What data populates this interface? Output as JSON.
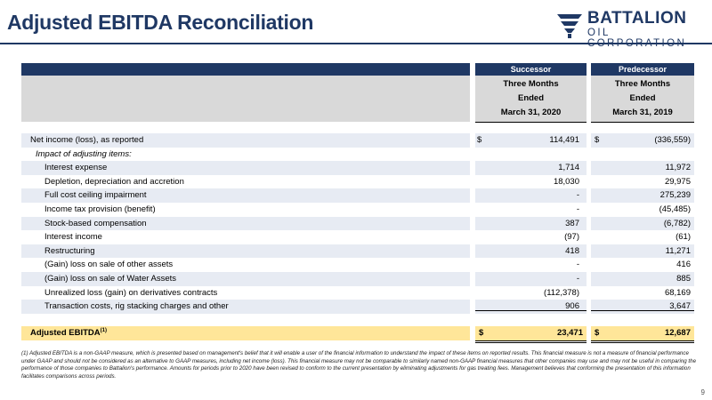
{
  "header": {
    "title": "Adjusted EBITDA Reconciliation",
    "logo_name": "BATTALION",
    "logo_sub": "OIL CORPORATION",
    "brand_color": "#1f3864"
  },
  "table": {
    "columns": [
      {
        "group": "Successor",
        "line1": "Three Months",
        "line2": "Ended",
        "line3": "March 31, 2020"
      },
      {
        "group": "Predecessor",
        "line1": "Three Months",
        "line2": "Ended",
        "line3": "March 31, 2019"
      }
    ],
    "rows": [
      {
        "label": "Net income (loss), as reported",
        "c1": "114,491",
        "c2": "(336,559)",
        "dollar": true
      },
      {
        "label": "Impact of adjusting items:",
        "c1": "",
        "c2": ""
      },
      {
        "label": "Interest expense",
        "c1": "1,714",
        "c2": "11,972"
      },
      {
        "label": "Depletion, depreciation and accretion",
        "c1": "18,030",
        "c2": "29,975"
      },
      {
        "label": "Full cost ceiling impairment",
        "c1": "-",
        "c2": "275,239"
      },
      {
        "label": "Income tax provision (benefit)",
        "c1": "-",
        "c2": "(45,485)"
      },
      {
        "label": "Stock-based compensation",
        "c1": "387",
        "c2": "(6,782)"
      },
      {
        "label": "Interest income",
        "c1": "(97)",
        "c2": "(61)"
      },
      {
        "label": "Restructuring",
        "c1": "418",
        "c2": "11,271"
      },
      {
        "label": "(Gain) loss on sale of other assets",
        "c1": "-",
        "c2": "416"
      },
      {
        "label": "(Gain) loss on sale of Water Assets",
        "c1": "-",
        "c2": "885"
      },
      {
        "label": "Unrealized loss (gain) on derivatives contracts",
        "c1": "(112,378)",
        "c2": "68,169"
      },
      {
        "label": "Transaction costs, rig stacking charges and other",
        "c1": "906",
        "c2": "3,647"
      }
    ],
    "total": {
      "label": "Adjusted EBITDA",
      "sup": "(1)",
      "c1": "23,471",
      "c2": "12,687"
    },
    "currency_symbol": "$"
  },
  "footnote": "(1) Adjusted EBITDA is a non-GAAP measure, which is presented based on management's belief that it will enable a user of the financial information to understand the impact of these items on reported results. This financial measure is not a measure of financial performance under GAAP and should not be considered as an alternative to GAAP measures, including net income (loss). This financial measure may not be comparable to similarly named non-GAAP financial measures that other companies may use and may not be useful in comparing the performance of those companies to Battalion's performance. Amounts for periods prior to 2020 have been revised to conform to the current presentation by eliminating adjustments for gas treating fees. Management believes that conforming the presentation of this information facilitates comparisons across periods.",
  "page_number": "9"
}
